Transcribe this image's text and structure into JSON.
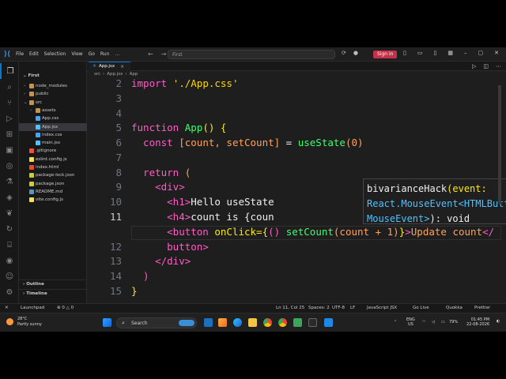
{
  "titlebar": {
    "menu": [
      "File",
      "Edit",
      "Selection",
      "View",
      "Go",
      "Run",
      "..."
    ],
    "search_placeholder": "First",
    "signin_label": "Sign in"
  },
  "explorer": {
    "root": "First",
    "items": [
      {
        "label": "node_modules",
        "depth": 1,
        "kind": "folder-closed"
      },
      {
        "label": "public",
        "depth": 1,
        "kind": "folder-closed"
      },
      {
        "label": "src",
        "depth": 1,
        "kind": "folder-open"
      },
      {
        "label": "assets",
        "depth": 2,
        "kind": "folder-closed"
      },
      {
        "label": "App.css",
        "depth": 2,
        "kind": "css"
      },
      {
        "label": "App.jsx",
        "depth": 2,
        "kind": "jsx",
        "selected": true
      },
      {
        "label": "index.css",
        "depth": 2,
        "kind": "css"
      },
      {
        "label": "main.jsx",
        "depth": 2,
        "kind": "jsx"
      },
      {
        "label": ".gitignore",
        "depth": 1,
        "kind": "git"
      },
      {
        "label": "eslint.config.js",
        "depth": 1,
        "kind": "js"
      },
      {
        "label": "index.html",
        "depth": 1,
        "kind": "html"
      },
      {
        "label": "package-lock.json",
        "depth": 1,
        "kind": "json"
      },
      {
        "label": "package.json",
        "depth": 1,
        "kind": "json"
      },
      {
        "label": "README.md",
        "depth": 1,
        "kind": "md"
      },
      {
        "label": "vite.config.js",
        "depth": 1,
        "kind": "js"
      }
    ],
    "outline_label": "Outline",
    "timeline_label": "Timeline"
  },
  "editor": {
    "tab_label": "App.jsx",
    "breadcrumb": [
      "src",
      "App.jsx",
      "App"
    ],
    "line_numbers": [
      "2",
      "3",
      "4",
      "5",
      "6",
      "7",
      "8",
      "9",
      "10",
      "11",
      "",
      "12",
      "13",
      "14",
      "15"
    ],
    "current_line_number": "11",
    "lines": {
      "l2a": "import ",
      "l2b": "'./App.css'",
      "l4a": "function ",
      "l4b": "App",
      "l4c": "() {",
      "l5a": "  const ",
      "l5b": "[count, setCount]",
      "l5c": " = ",
      "l5d": "useState",
      "l5e": "(0)",
      "l7a": "  return ",
      "l7b": "(",
      "l8": "    <div>",
      "l9a": "      <h1>",
      "l9b": "Hello useState",
      "l10a": "      <h4>",
      "l10b": "count is {coun",
      "l11a": "      <button ",
      "l11b": "onClick",
      "l11c": "={",
      "l11d": "()",
      "l11e": " setCount",
      "l11f": "(count + 1)",
      "l11g": "}",
      "l11h": ">",
      "l11i": "Update count",
      "l11j": "</",
      "l11w": "      button>",
      "l12": "    </div>",
      "l13": "  )",
      "l14": "}"
    },
    "hover": {
      "name": "bivarianceHack",
      "p1": "(event:",
      "type1": "React.MouseEvent<HTMLButton",
      "type2": "MouseEvent>",
      "ret": "): void"
    }
  },
  "statusbar": {
    "left": "⊗ 0 ⚠ 0",
    "launchpad": "Launchpad",
    "warnings": "⊗ 0 △ 0",
    "position": "Ln 11, Col 25",
    "spaces": "Spaces: 2",
    "encoding": "UTF-8",
    "eol": "LF",
    "language": "JavaScript JSX",
    "golive": "Go Live",
    "quokka": "Quokka",
    "prettier": "Prettier"
  },
  "taskbar": {
    "weather_temp": "28°C",
    "weather_desc": "Partly sunny",
    "search_placeholder": "Search",
    "lang_top": "ENG",
    "lang_bottom": "US",
    "battery": "79%",
    "time": "01:45 PM",
    "date": "22-08-2026"
  },
  "colors": {
    "accent": "#0078d4",
    "signin": "#c4314b",
    "keyword": "#ff5cc6",
    "string": "#ffd700",
    "function": "#3dff6e"
  }
}
